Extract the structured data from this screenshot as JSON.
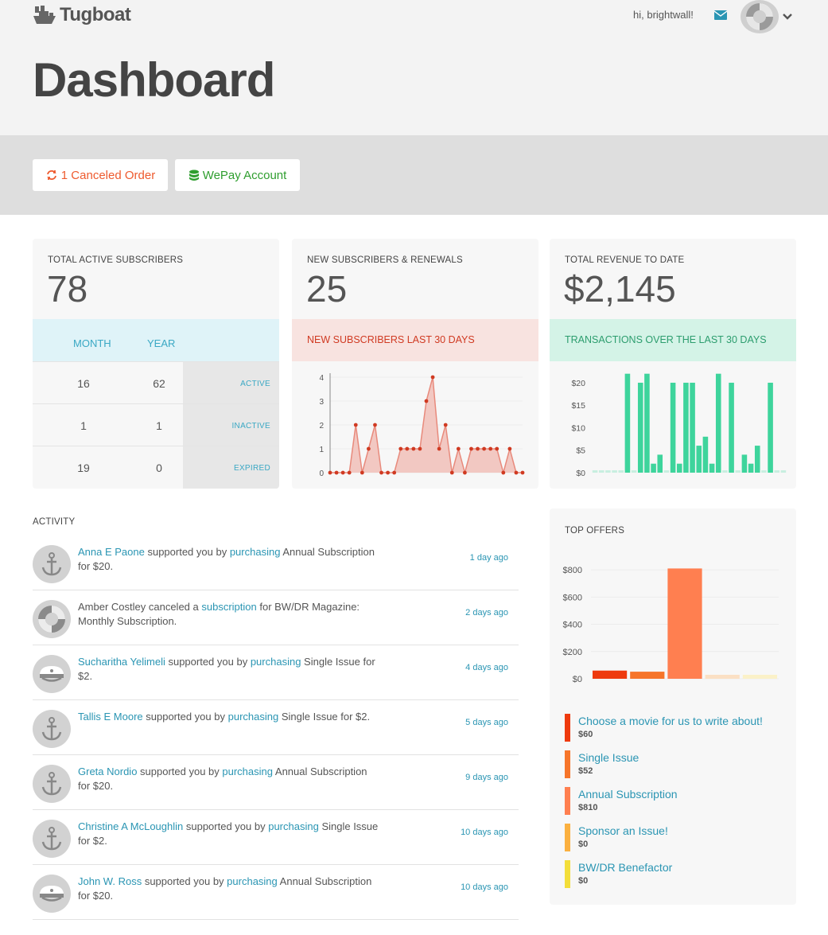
{
  "brand": {
    "name": "Tugboat"
  },
  "header": {
    "greeting": "hi, brightwall!",
    "page_title": "Dashboard"
  },
  "actions": {
    "canceled_order": "1 Canceled Order",
    "wepay_account": "WePay Account"
  },
  "stats": {
    "subscribers": {
      "label": "TOTAL ACTIVE SUBSCRIBERS",
      "value": "78",
      "col_month": "MONTH",
      "col_year": "YEAR",
      "rows": [
        {
          "month": "16",
          "year": "62",
          "status": "ACTIVE"
        },
        {
          "month": "1",
          "year": "1",
          "status": "INACTIVE"
        },
        {
          "month": "19",
          "year": "0",
          "status": "EXPIRED"
        }
      ]
    },
    "new_subscribers": {
      "label": "NEW SUBSCRIBERS & RENEWALS",
      "value": "25",
      "band": "NEW SUBSCRIBERS LAST 30 DAYS"
    },
    "revenue": {
      "label": "TOTAL REVENUE TO DATE",
      "value": "$2,145",
      "band": "TRANSACTIONS OVER THE LAST 30 DAYS"
    }
  },
  "colors": {
    "accent_blue": "#2a95b3",
    "line_red": "#d03a22",
    "area_red": "#f2c8c2",
    "bar_green": "#3ed49c",
    "bar_green_empty": "#c8efe0"
  },
  "chart_data": [
    {
      "type": "area",
      "ylim": [
        0,
        4
      ],
      "yticks": [
        "0",
        "1",
        "2",
        "3",
        "4"
      ],
      "values": [
        0,
        0,
        0,
        0,
        2,
        0,
        1,
        2,
        0,
        0,
        0,
        1,
        1,
        1,
        1,
        3,
        4,
        1,
        2,
        0,
        1,
        0,
        1,
        1,
        1,
        1,
        1,
        0,
        1,
        0,
        0
      ]
    },
    {
      "type": "bar",
      "ylim": [
        0,
        23
      ],
      "yticks": [
        "$0",
        "$5",
        "$10",
        "$15",
        "$20"
      ],
      "values": [
        0,
        0,
        0,
        0,
        0,
        22,
        0,
        20,
        22,
        2,
        4,
        0,
        20,
        2,
        20,
        20,
        6,
        8,
        2,
        22,
        0,
        20,
        0,
        4,
        2,
        6,
        0,
        20,
        0,
        0
      ]
    },
    {
      "type": "bar",
      "ylim": [
        0,
        900
      ],
      "yticks": [
        "$0",
        "$200",
        "$400",
        "$600",
        "$800"
      ],
      "categories": [
        "Choose a movie for us to write about!",
        "Single Issue",
        "Annual Subscription",
        "Sponsor an Issue!",
        "BW/DR Benefactor"
      ],
      "values": [
        60,
        52,
        810,
        0,
        0
      ],
      "colors": [
        "#ee3a0e",
        "#f6752a",
        "#ff7f50",
        "#fbe0c4",
        "#fbf1c8"
      ]
    }
  ],
  "activity": {
    "title": "ACTIVITY",
    "items": [
      {
        "avatar": "anchor",
        "name": "Anna E Paone",
        "mid": " supported you by ",
        "link": "purchasing",
        "rest": " Annual Subscription for $20.",
        "time": "1 day ago"
      },
      {
        "avatar": "lifebuoy",
        "name": "Amber Costley canceled a ",
        "mid": "",
        "link": "subscription",
        "rest": " for BW/DR Magazine: Monthly Subscription.",
        "time": "2 days ago"
      },
      {
        "avatar": "captain-hat",
        "name": "Sucharitha Yelimeli",
        "mid": " supported you by ",
        "link": "purchasing",
        "rest": " Single Issue for $2.",
        "time": "4 days ago"
      },
      {
        "avatar": "anchor",
        "name": "Tallis E Moore",
        "mid": " supported you by ",
        "link": "purchasing",
        "rest": " Single Issue for $2.",
        "time": "5 days ago"
      },
      {
        "avatar": "anchor",
        "name": "Greta Nordio",
        "mid": " supported you by ",
        "link": "purchasing",
        "rest": " Annual Subscription for $20.",
        "time": "9 days ago"
      },
      {
        "avatar": "anchor",
        "name": "Christine A McLoughlin",
        "mid": " supported you by ",
        "link": "purchasing",
        "rest": " Single Issue for $2.",
        "time": "10 days ago"
      },
      {
        "avatar": "captain-hat",
        "name": "John W. Ross",
        "mid": " supported you by ",
        "link": "purchasing",
        "rest": " Annual Subscription for $20.",
        "time": "10 days ago"
      }
    ]
  },
  "offers": {
    "title": "TOP OFFERS",
    "items": [
      {
        "name": "Choose a movie for us to write about!",
        "price": "$60",
        "color": "#ee3a0e"
      },
      {
        "name": "Single Issue",
        "price": "$52",
        "color": "#f6752a"
      },
      {
        "name": "Annual Subscription",
        "price": "$810",
        "color": "#ff7f50"
      },
      {
        "name": "Sponsor an Issue!",
        "price": "$0",
        "color": "#fbb040"
      },
      {
        "name": "BW/DR Benefactor",
        "price": "$0",
        "color": "#f3de3a"
      }
    ]
  }
}
